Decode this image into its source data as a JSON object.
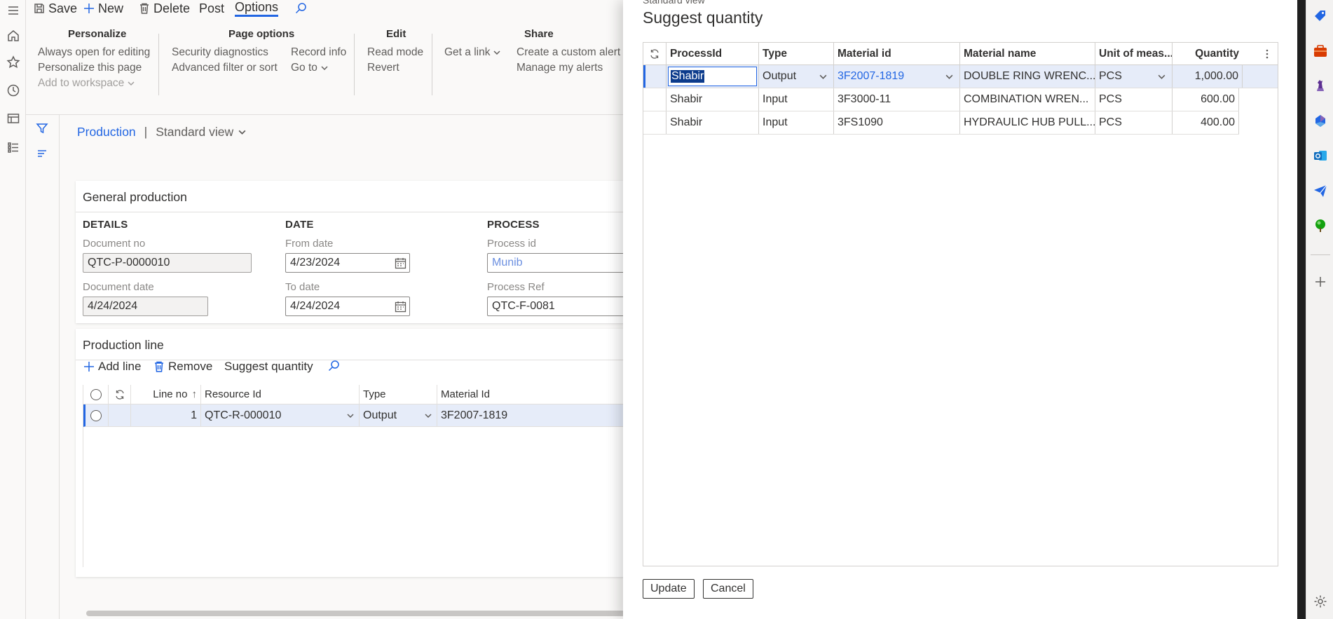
{
  "left_rail": {
    "icons": [
      "hamburger-icon",
      "home-icon",
      "star-icon",
      "clock-icon",
      "workspace-icon",
      "modules-icon"
    ]
  },
  "action_pane": {
    "save": "Save",
    "new": "New",
    "delete": "Delete",
    "post": "Post",
    "options": "Options"
  },
  "ribbon": {
    "personalize": {
      "title": "Personalize",
      "always_open": "Always open for editing",
      "personalize_page": "Personalize this page",
      "add_workspace": "Add to workspace"
    },
    "page_options": {
      "title": "Page options",
      "security": "Security diagnostics",
      "advanced_filter": "Advanced filter or sort",
      "record_info": "Record info",
      "go_to": "Go to"
    },
    "edit": {
      "title": "Edit",
      "read_mode": "Read mode",
      "revert": "Revert"
    },
    "share": {
      "title": "Share",
      "get_link": "Get a link",
      "custom_alert": "Create a custom alert",
      "manage_alerts": "Manage my alerts"
    }
  },
  "breadcrumb": {
    "page": "Production",
    "separator": "|",
    "view": "Standard view"
  },
  "general": {
    "title": "General production",
    "details": {
      "heading": "DETAILS",
      "doc_no_label": "Document no",
      "doc_no": "QTC-P-0000010",
      "doc_date_label": "Document date",
      "doc_date": "4/24/2024"
    },
    "date": {
      "heading": "DATE",
      "from_label": "From date",
      "from": "4/23/2024",
      "to_label": "To date",
      "to": "4/24/2024"
    },
    "process": {
      "heading": "PROCESS",
      "id_label": "Process id",
      "id": "Munib",
      "ref_label": "Process Ref",
      "ref": "QTC-F-0081"
    }
  },
  "production_line": {
    "title": "Production line",
    "add_line": "Add line",
    "remove": "Remove",
    "suggest": "Suggest quantity",
    "columns": {
      "line_no": "Line no",
      "resource": "Resource Id",
      "type": "Type",
      "material": "Material Id"
    },
    "row": {
      "line_no": "1",
      "resource": "QTC-R-000010",
      "type": "Output",
      "material": "3F2007-1819"
    }
  },
  "dialog": {
    "ghost": "Standard view",
    "title": "Suggest quantity",
    "columns": {
      "process": "ProcessId",
      "type": "Type",
      "material_id": "Material id",
      "material_name": "Material name",
      "unit": "Unit of meas...",
      "quantity": "Quantity"
    },
    "rows": [
      {
        "process": "Shabir",
        "type": "Output",
        "material_id": "3F2007-1819",
        "material_name": "DOUBLE RING WRENC...",
        "unit": "PCS",
        "quantity": "1,000.00"
      },
      {
        "process": "Shabir",
        "type": "Input",
        "material_id": "3F3000-11",
        "material_name": "COMBINATION WREN...",
        "unit": "PCS",
        "quantity": "600.00"
      },
      {
        "process": "Shabir",
        "type": "Input",
        "material_id": "3FS1090",
        "material_name": "HYDRAULIC HUB PULL...",
        "unit": "PCS",
        "quantity": "400.00"
      }
    ],
    "update": "Update",
    "cancel": "Cancel"
  },
  "sidebar": {
    "icons": [
      "tag-icon",
      "briefcase-icon",
      "chess-icon",
      "copilot-icon",
      "outlook-icon",
      "send-icon",
      "tree-icon",
      "add-icon",
      "settings-icon"
    ],
    "colors": {
      "blue": "#2266e3",
      "orange": "#d83b01",
      "green": "#13a10e",
      "purple": "#8764b8"
    }
  }
}
